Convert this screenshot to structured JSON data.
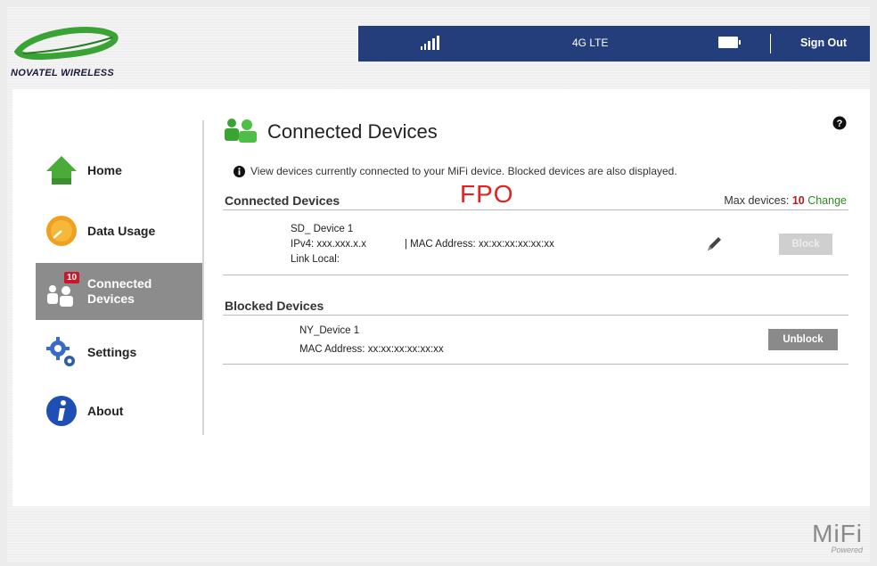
{
  "brand": {
    "logo_text": "NOVATEL WIRELESS",
    "footer_mark": "MiFi",
    "footer_sub": "Powered"
  },
  "status": {
    "network": "4G LTE",
    "signout_label": "Sign Out"
  },
  "sidebar": {
    "items": [
      {
        "label": "Home"
      },
      {
        "label": "Data Usage"
      },
      {
        "label": "Connected",
        "label2": "Devices",
        "badge": "10"
      },
      {
        "label": "Settings"
      },
      {
        "label": "About"
      }
    ]
  },
  "main": {
    "title": "Connected Devices",
    "info": "View devices currently connected to your MiFi device. Blocked devices are also displayed.",
    "placeholder_mark": "FPO",
    "connected": {
      "heading": "Connected Devices",
      "max_label": "Max devices: ",
      "max_count": "10",
      "change_label": "Change",
      "device": {
        "name": "SD_ Device 1",
        "ipv4": "IPv4: xxx.xxx.x.x",
        "mac": "| MAC Address: xx:xx:xx:xx:xx:xx",
        "link_local": "Link Local:",
        "block_label": "Block"
      }
    },
    "blocked": {
      "heading": "Blocked Devices",
      "device": {
        "name": "NY_Device 1",
        "mac": "MAC Address: xx:xx:xx:xx:xx:xx",
        "unblock_label": "Unblock"
      }
    }
  },
  "colors": {
    "statusbar": "#243e7c",
    "active_nav": "#8c8c8c",
    "fpo": "#e62020",
    "change": "#2c8a1f"
  }
}
